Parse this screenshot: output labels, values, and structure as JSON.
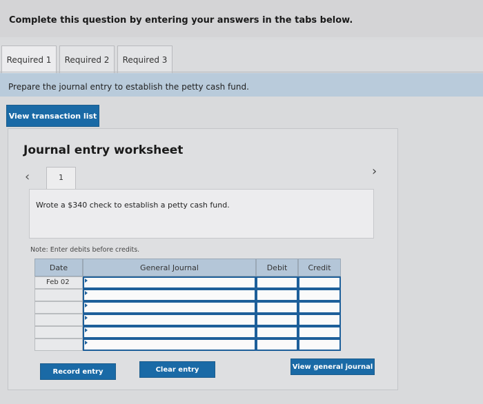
{
  "header": {
    "instruction": "Complete this question by entering your answers in the tabs below."
  },
  "tabs": [
    {
      "label": "Required 1",
      "active": true
    },
    {
      "label": "Required 2",
      "active": false
    },
    {
      "label": "Required 3",
      "active": false
    }
  ],
  "instruction_bar": {
    "text": "Prepare the journal entry to establish the petty cash fund."
  },
  "buttons": {
    "view_transaction_list": "View transaction list",
    "record_entry": "Record entry",
    "clear_entry": "Clear entry",
    "view_general_journal": "View general journal"
  },
  "worksheet": {
    "title": "Journal entry worksheet",
    "entry_number": "1",
    "description": "Wrote a $340 check to establish a petty cash fund.",
    "note": "Note: Enter debits before credits."
  },
  "journal_table": {
    "headers": {
      "date": "Date",
      "general_journal": "General Journal",
      "debit": "Debit",
      "credit": "Credit"
    },
    "rows": [
      {
        "date": "Feb 02",
        "account": "",
        "debit": "",
        "credit": ""
      },
      {
        "date": "",
        "account": "",
        "debit": "",
        "credit": ""
      },
      {
        "date": "",
        "account": "",
        "debit": "",
        "credit": ""
      },
      {
        "date": "",
        "account": "",
        "debit": "",
        "credit": ""
      },
      {
        "date": "",
        "account": "",
        "debit": "",
        "credit": ""
      },
      {
        "date": "",
        "account": "",
        "debit": "",
        "credit": ""
      }
    ]
  },
  "icons": {
    "prev": "chevron-left-icon",
    "next": "chevron-right-icon"
  },
  "colors": {
    "button_blue": "#1a6aa6",
    "header_blue": "#b4c6d8",
    "cell_border_blue": "#1d5f9a"
  }
}
